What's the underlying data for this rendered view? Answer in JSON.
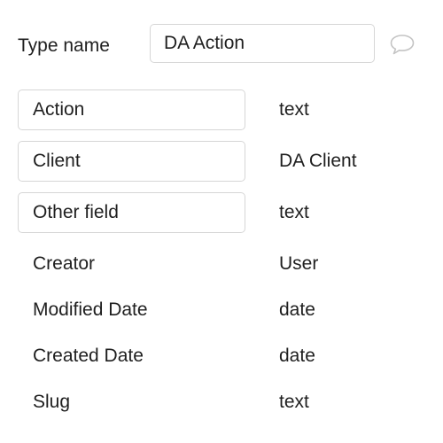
{
  "type_name": {
    "label": "Type name",
    "value": "DA Action"
  },
  "comment_icon": "speech-bubble-icon",
  "editable_fields": [
    {
      "name": "Action",
      "type": "text"
    },
    {
      "name": "Client",
      "type": "DA Client"
    },
    {
      "name": "Other field",
      "type": "text"
    }
  ],
  "builtin_fields": [
    {
      "name": "Creator",
      "type": "User"
    },
    {
      "name": "Modified Date",
      "type": "date"
    },
    {
      "name": "Created Date",
      "type": "date"
    },
    {
      "name": "Slug",
      "type": "text"
    }
  ],
  "colors": {
    "border": "#d6d6d6",
    "text": "#1f1f1f",
    "icon": "#c4c4c4"
  }
}
